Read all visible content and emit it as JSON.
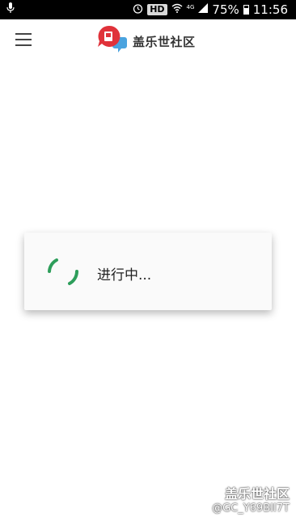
{
  "status_bar": {
    "hd_badge": "HD",
    "network": "4G",
    "battery": "75%",
    "time": "11:56",
    "icons": [
      "mic-icon",
      "alarm-icon",
      "wifi-icon",
      "signal-icon",
      "battery-icon"
    ]
  },
  "app_bar": {
    "menu_icon": "hamburger-menu-icon",
    "logo_icon": "speech-bubble-logo-icon",
    "title": "盖乐世社区",
    "colors": {
      "logo_red": "#e0323a",
      "logo_blue": "#4aa3df"
    }
  },
  "dialog": {
    "message": "进行中...",
    "spinner_color": "#2e9e5b"
  },
  "watermark": {
    "brand": "盖乐世社区",
    "user": "@GC_Y69BII7T"
  }
}
